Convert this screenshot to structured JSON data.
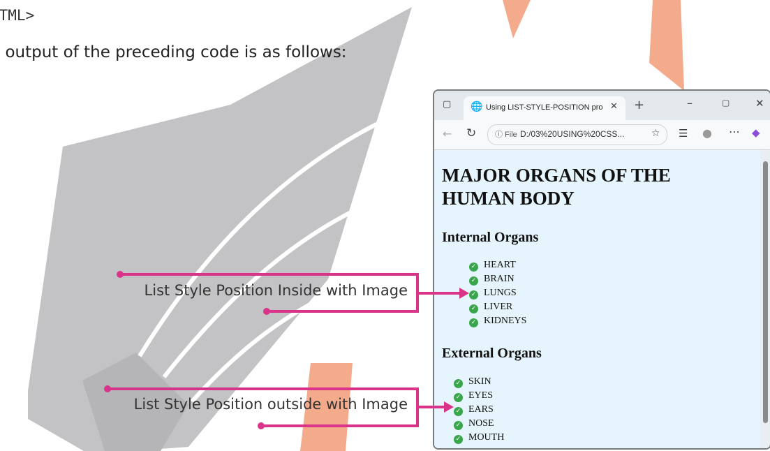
{
  "document": {
    "code_tail": "HTML>",
    "intro_text": "e output of the preceding code is as follows:"
  },
  "callouts": {
    "inside": "List Style Position Inside with Image",
    "outside": "List Style Position outside with Image"
  },
  "browser": {
    "tab_title": "Using LIST-STYLE-POSITION pro",
    "file_badge": "ⓘ File",
    "url": "D:/03%20USING%20CSS...",
    "page": {
      "heading": "MAJOR ORGANS OF THE HUMAN BODY",
      "internal": {
        "heading": "Internal Organs",
        "items": [
          "HEART",
          "BRAIN",
          "LUNGS",
          "LIVER",
          "KIDNEYS"
        ]
      },
      "external": {
        "heading": "External Organs",
        "items": [
          "SKIN",
          "EYES",
          "EARS",
          "NOSE",
          "MOUTH"
        ]
      }
    }
  },
  "colors": {
    "callout": "#d9338a",
    "watermark_cap": "#c3c3c5",
    "watermark_letters": "#f0a07e",
    "check": "#3aa64b"
  },
  "icons": [
    "graduation-cap-watermark",
    "tab-actions-icon",
    "globe-icon",
    "close-icon",
    "plus-icon",
    "minimize-icon",
    "maximize-icon",
    "back-icon",
    "refresh-icon",
    "favorite-icon",
    "collections-icon",
    "profile-icon",
    "more-icon",
    "copilot-icon",
    "check-circle-icon"
  ]
}
